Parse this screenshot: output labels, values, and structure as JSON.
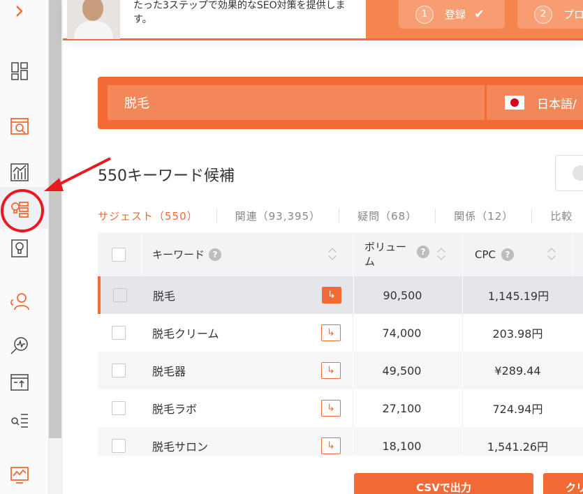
{
  "rail": {
    "items": [
      "expand-chevron-icon",
      "dashboard-icon",
      "site-audit-icon",
      "traffic-chart-icon",
      "keyword-ideas-icon",
      "content-ideas-icon",
      "backlinks-icon",
      "traffic-analyzer-icon",
      "rank-tracker-icon",
      "keyword-search-icon",
      "traffic-trend-icon"
    ]
  },
  "banner": {
    "message": "たった3ステップで効果的なSEO対策を提供します。",
    "steps": [
      {
        "num": "1",
        "label": "登録"
      },
      {
        "num": "2",
        "label": "プロ"
      }
    ]
  },
  "search": {
    "keyword": "脱毛",
    "language": "日本語/"
  },
  "results": {
    "heading": "550キーワード候補"
  },
  "tabs": [
    {
      "label": "サジェスト（550）"
    },
    {
      "label": "関連（93,395）"
    },
    {
      "label": "疑問（68）"
    },
    {
      "label": "関係（12）"
    },
    {
      "label": "比較"
    }
  ],
  "table": {
    "headers": {
      "keyword": "キーワード",
      "volume": "ボリューム",
      "cpc": "CPC"
    },
    "rows": [
      {
        "keyword": "脱毛",
        "volume": "90,500",
        "cpc": "1,145.19円"
      },
      {
        "keyword": "脱毛クリーム",
        "volume": "74,000",
        "cpc": "203.98円"
      },
      {
        "keyword": "脱毛器",
        "volume": "49,500",
        "cpc": "¥289.44"
      },
      {
        "keyword": "脱毛ラボ",
        "volume": "27,100",
        "cpc": "724.94円"
      },
      {
        "keyword": "脱毛サロン",
        "volume": "18,100",
        "cpc": "1,541.26円"
      }
    ]
  },
  "actions": {
    "csv": "CSVで出力",
    "copy": "クリ"
  },
  "colors": {
    "accent": "#f26a35",
    "annotation": "#e8191f"
  }
}
